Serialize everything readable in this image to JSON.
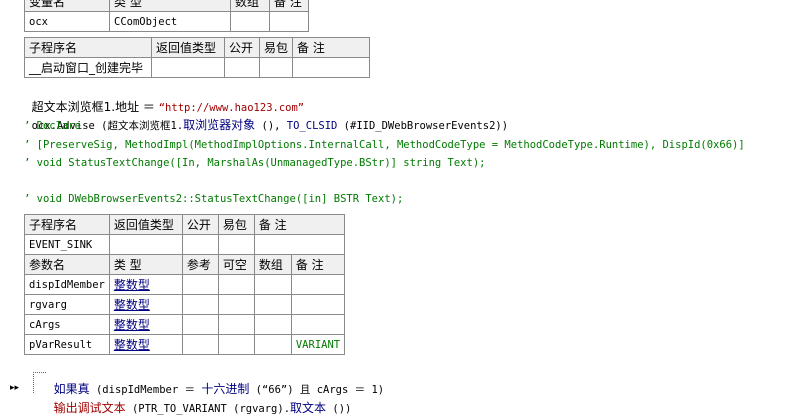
{
  "top_table": {
    "header": [
      "变量名",
      "类 型",
      "数组",
      "备 注"
    ],
    "row": [
      "ocx",
      "CComObject",
      "",
      ""
    ]
  },
  "sub1": {
    "header": [
      "子程序名",
      "返回值类型",
      "公开",
      "易包",
      "备 注"
    ],
    "row": [
      "__启动窗口_创建完毕",
      "",
      "",
      "",
      ""
    ]
  },
  "code_lines": {
    "l1_a": "超文本浏览框1.地址 ＝ ",
    "l1_b": "“http://www.hao123.com”",
    "l2_a": "ocx.Advise (超文本浏览框1.",
    "l2_b": "取浏览器对象",
    "l2_c": " (), ",
    "l2_d": "TO_CLSID",
    "l2_e": " (#IID_DWebBrowserEvents2))",
    "c1": "’ Declare",
    "c2": "’ [PreserveSig, MethodImpl(MethodImplOptions.InternalCall, MethodCodeType = MethodCodeType.Runtime), DispId(0x66)]",
    "c3": "’ void StatusTextChange([In, MarshalAs(UnmanagedType.BStr)] string Text);",
    "c4": "’ void DWebBrowserEvents2::StatusTextChange([in] BSTR Text);"
  },
  "sub2": {
    "header": [
      "子程序名",
      "返回值类型",
      "公开",
      "易包",
      "备 注"
    ],
    "row": [
      "EVENT_SINK",
      "",
      "",
      "",
      ""
    ],
    "param_header": [
      "参数名",
      "类 型",
      "参考",
      "可空",
      "数组",
      "备 注"
    ],
    "params": [
      {
        "name": "dispIdMember",
        "type": "整数型",
        "note": ""
      },
      {
        "name": "rgvarg",
        "type": "整数型",
        "note": ""
      },
      {
        "name": "cArgs",
        "type": "整数型",
        "note": ""
      },
      {
        "name": "pVarResult",
        "type": "整数型",
        "note": "VARIANT"
      }
    ]
  },
  "body_lines": {
    "b1_a": "如果真",
    "b1_b": " (dispIdMember ＝ ",
    "b1_c": "十六进制",
    "b1_d": " (“66”) 且 cArgs ＝ 1)",
    "b2_a": "输出调试文本",
    "b2_b": " (PTR_TO_VARIANT (rgvarg).",
    "b2_c": "取文本",
    "b2_d": " ())"
  }
}
